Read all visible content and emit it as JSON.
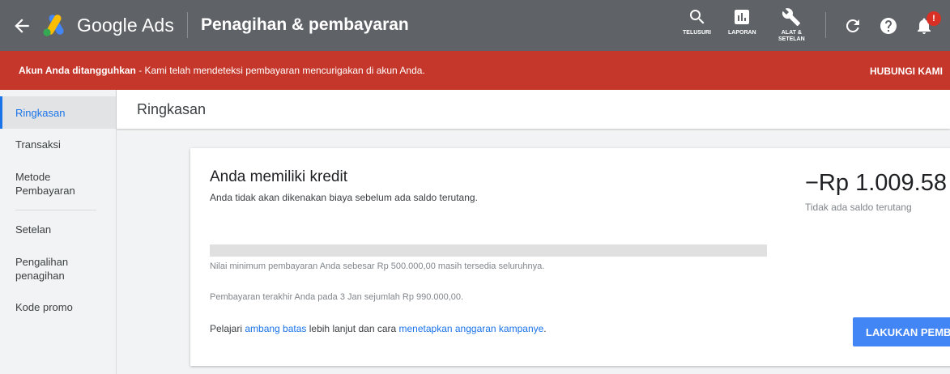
{
  "header": {
    "brand": "Google Ads",
    "page_title": "Penagihan & pembayaran",
    "tools": [
      {
        "icon": "search-icon",
        "label": "TELUSURI"
      },
      {
        "icon": "bar-chart-icon",
        "label": "LAPORAN"
      },
      {
        "icon": "wrench-icon",
        "label_line1": "ALAT &",
        "label_line2": "SETELAN"
      }
    ],
    "notification_badge": "!"
  },
  "alert": {
    "bold_text": "Akun Anda ditangguhkan",
    "text": " - Kami telah mendeteksi pembayaran mencurigakan di akun Anda.",
    "action": "HUBUNGI KAMI",
    "color": "#c5372b"
  },
  "sidebar": {
    "items": [
      {
        "label": "Ringkasan",
        "active": true
      },
      {
        "label": "Transaksi"
      },
      {
        "label_line1": "Metode",
        "label_line2": "Pembayaran"
      },
      {
        "label": "Setelan"
      },
      {
        "label_line1": "Pengalihan",
        "label_line2": "penagihan"
      },
      {
        "label": "Kode promo"
      }
    ]
  },
  "main": {
    "title": "Ringkasan",
    "card": {
      "title": "Anda memiliki kredit",
      "subtitle": "Anda tidak akan dikenakan biaya sebelum ada saldo terutang.",
      "amount": "−Rp 1.009.58",
      "amount_sub": "Tidak ada saldo terutang",
      "progress_fraction": 0,
      "note_min_payment": "Nilai minimum pembayaran Anda sebesar Rp 500.000,00 masih tersedia seluruhnya.",
      "note_last_payment": "Pembayaran terakhir Anda pada 3 Jan sejumlah Rp 990.000,00.",
      "learn_prefix": "Pelajari ",
      "learn_link1": "ambang batas",
      "learn_middle": " lebih lanjut dan cara ",
      "learn_link2": "menetapkan anggaran kampanye",
      "learn_suffix": ".",
      "pay_button": "LAKUKAN PEMBAYARAN"
    }
  },
  "colors": {
    "accent": "#1a73e8",
    "topbar": "#5f6368",
    "button": "#4285f4"
  }
}
